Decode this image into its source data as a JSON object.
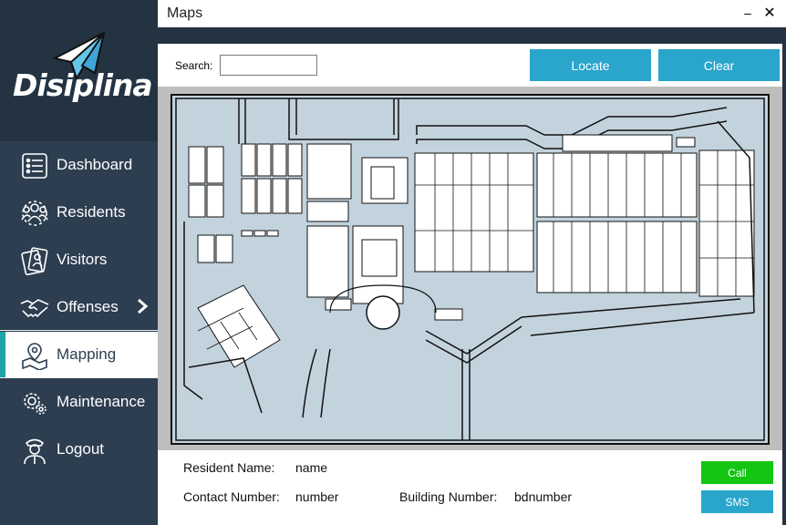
{
  "app": {
    "logo_text": "Disiplina",
    "window_title": "Maps"
  },
  "window_controls": {
    "minimize": "–",
    "close": "✕"
  },
  "sidebar": {
    "items": [
      {
        "label": "Dashboard",
        "icon": "dashboard-list-icon"
      },
      {
        "label": "Residents",
        "icon": "residents-group-icon"
      },
      {
        "label": "Visitors",
        "icon": "visitors-badge-icon"
      },
      {
        "label": "Offenses",
        "icon": "handshake-icon",
        "chevron": "›"
      },
      {
        "label": "Mapping",
        "icon": "map-pin-icon",
        "active": true
      },
      {
        "label": "Maintenance",
        "icon": "gears-icon"
      },
      {
        "label": "Logout",
        "icon": "officer-icon"
      }
    ]
  },
  "toolbar": {
    "search_label": "Search:",
    "search_value": "",
    "locate_label": "Locate",
    "clear_label": "Clear"
  },
  "info": {
    "resident_name_label": "Resident Name:",
    "resident_name_value": "name",
    "contact_label": "Contact Number:",
    "contact_value": "number",
    "building_label": "Building Number:",
    "building_value": "bdnumber",
    "call_label": "Call",
    "sms_label": "SMS"
  },
  "colors": {
    "sidebar_bg": "#2c3e50",
    "logo_bg": "#233342",
    "accent": "#1fa3a8",
    "button_blue": "#2aa5cc",
    "call_green": "#14c514",
    "map_water": "#c3d3de"
  }
}
